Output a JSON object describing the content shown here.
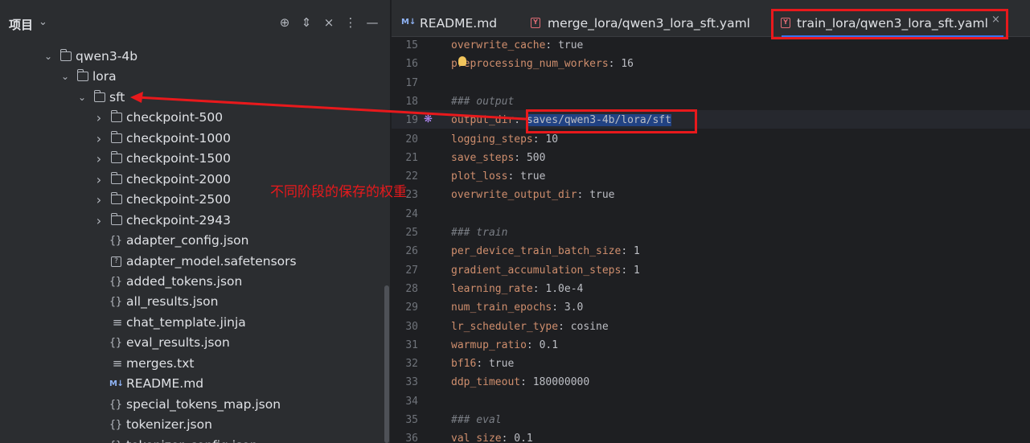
{
  "project_panel": {
    "title": "项目",
    "header_actions": [
      "crosshair-icon",
      "expand-collapse-icon",
      "collapse-all-icon",
      "more-icon",
      "minimize-icon"
    ],
    "tree": [
      {
        "name": "qwen3-4b",
        "type": "folder",
        "expanded": true,
        "depth": 0
      },
      {
        "name": "lora",
        "type": "folder",
        "expanded": true,
        "depth": 1
      },
      {
        "name": "sft",
        "type": "folder",
        "expanded": true,
        "depth": 2
      },
      {
        "name": "checkpoint-500",
        "type": "folder",
        "expanded": false,
        "depth": 3
      },
      {
        "name": "checkpoint-1000",
        "type": "folder",
        "expanded": false,
        "depth": 3
      },
      {
        "name": "checkpoint-1500",
        "type": "folder",
        "expanded": false,
        "depth": 3
      },
      {
        "name": "checkpoint-2000",
        "type": "folder",
        "expanded": false,
        "depth": 3
      },
      {
        "name": "checkpoint-2500",
        "type": "folder",
        "expanded": false,
        "depth": 3
      },
      {
        "name": "checkpoint-2943",
        "type": "folder",
        "expanded": false,
        "depth": 3
      },
      {
        "name": "adapter_config.json",
        "type": "json",
        "depth": 3
      },
      {
        "name": "adapter_model.safetensors",
        "type": "binary",
        "depth": 3
      },
      {
        "name": "added_tokens.json",
        "type": "json",
        "depth": 3
      },
      {
        "name": "all_results.json",
        "type": "json",
        "depth": 3
      },
      {
        "name": "chat_template.jinja",
        "type": "text",
        "depth": 3
      },
      {
        "name": "eval_results.json",
        "type": "json",
        "depth": 3
      },
      {
        "name": "merges.txt",
        "type": "text",
        "depth": 3
      },
      {
        "name": "README.md",
        "type": "md",
        "depth": 3
      },
      {
        "name": "special_tokens_map.json",
        "type": "json",
        "depth": 3
      },
      {
        "name": "tokenizer.json",
        "type": "json",
        "depth": 3
      },
      {
        "name": "tokenizer_config.json",
        "type": "json",
        "depth": 3
      }
    ]
  },
  "tabs": [
    {
      "label": "README.md",
      "icon": "markdown-icon",
      "icon_text": "M↓",
      "active": false
    },
    {
      "label": "merge_lora/qwen3_lora_sft.yaml",
      "icon": "yaml-icon",
      "icon_text": "Y",
      "active": false
    },
    {
      "label": "train_lora/qwen3_lora_sft.yaml",
      "icon": "yaml-icon",
      "icon_text": "Y",
      "active": true
    }
  ],
  "tab_close_glyph": "×",
  "code_lines": [
    {
      "n": "15",
      "key": "overwrite_cache",
      "value": "true"
    },
    {
      "n": "16",
      "key": "preprocessing_num_workers",
      "value": "16"
    },
    {
      "n": "17"
    },
    {
      "n": "18",
      "comment": "### output"
    },
    {
      "n": "19",
      "key": "output_dir",
      "value": "saves/qwen3-4b/lora/sft",
      "selected": true
    },
    {
      "n": "20",
      "key": "logging_steps",
      "value": "10"
    },
    {
      "n": "21",
      "key": "save_steps",
      "value": "500"
    },
    {
      "n": "22",
      "key": "plot_loss",
      "value": "true"
    },
    {
      "n": "23",
      "key": "overwrite_output_dir",
      "value": "true"
    },
    {
      "n": "24"
    },
    {
      "n": "25",
      "comment": "### train"
    },
    {
      "n": "26",
      "key": "per_device_train_batch_size",
      "value": "1"
    },
    {
      "n": "27",
      "key": "gradient_accumulation_steps",
      "value": "1"
    },
    {
      "n": "28",
      "key": "learning_rate",
      "value": "1.0e-4"
    },
    {
      "n": "29",
      "key": "num_train_epochs",
      "value": "3.0"
    },
    {
      "n": "30",
      "key": "lr_scheduler_type",
      "value": "cosine"
    },
    {
      "n": "31",
      "key": "warmup_ratio",
      "value": "0.1"
    },
    {
      "n": "32",
      "key": "bf16",
      "value": "true"
    },
    {
      "n": "33",
      "key": "ddp_timeout",
      "value": "180000000"
    },
    {
      "n": "34"
    },
    {
      "n": "35",
      "comment": "### eval"
    },
    {
      "n": "36",
      "key": "val_size",
      "value": "0.1"
    }
  ],
  "annotation": {
    "text": "不同阶段的保存的权重",
    "color": "#e8191c"
  },
  "colors": {
    "panel_bg": "#2b2d30",
    "editor_bg": "#1e1f22",
    "yaml_key": "#cf8e6d",
    "selection": "#214283",
    "accent": "#3574f0"
  }
}
